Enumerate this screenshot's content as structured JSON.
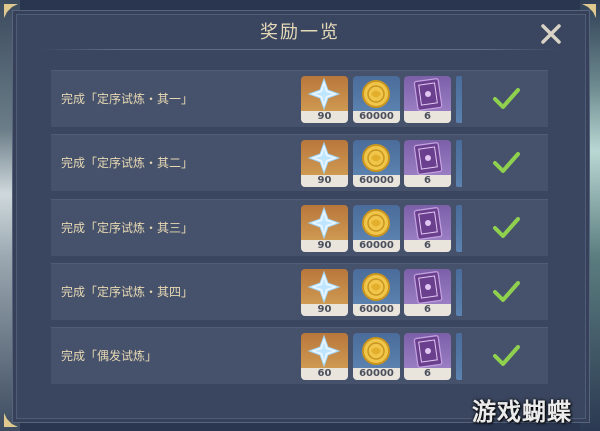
{
  "dialog": {
    "title": "奖励一览",
    "close_icon": "close-icon"
  },
  "rows": [
    {
      "label": "完成「定序试炼・其一」",
      "primogem": "90",
      "mora": "60000",
      "book": "6",
      "completed": true
    },
    {
      "label": "完成「定序试炼・其二」",
      "primogem": "90",
      "mora": "60000",
      "book": "6",
      "completed": true
    },
    {
      "label": "完成「定序试炼・其三」",
      "primogem": "90",
      "mora": "60000",
      "book": "6",
      "completed": true
    },
    {
      "label": "完成「定序试炼・其四」",
      "primogem": "90",
      "mora": "60000",
      "book": "6",
      "completed": true
    },
    {
      "label": "完成「偶发试炼」",
      "primogem": "60",
      "mora": "60000",
      "book": "6",
      "completed": true
    }
  ],
  "icons": {
    "primogem": "primogem-icon",
    "mora": "mora-coin-icon",
    "book": "experience-book-icon",
    "check": "checkmark-icon"
  },
  "colors": {
    "panel": "#3a465f",
    "row": "#46526b",
    "title": "#e6d9b8",
    "check": "#8fd14f",
    "gold_frame": "#c48a45",
    "blue_frame": "#4f76a6",
    "purple_frame": "#8a6fb8"
  },
  "watermark": "游戏蝴蝶"
}
